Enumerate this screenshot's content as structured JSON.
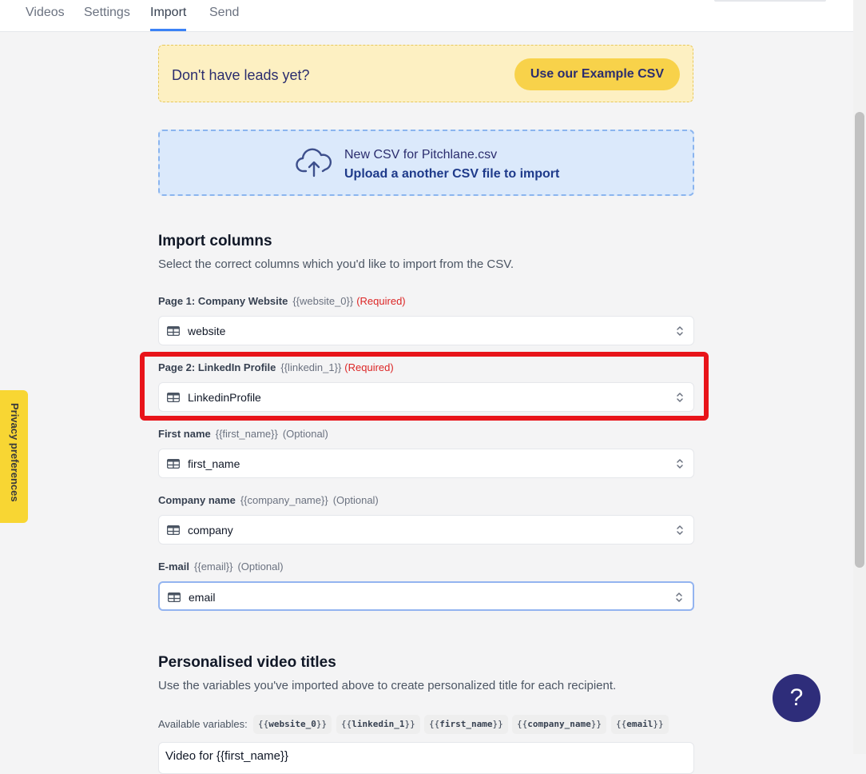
{
  "nav": {
    "tabs": [
      {
        "label": "Videos"
      },
      {
        "label": "Settings"
      },
      {
        "label": "Import"
      },
      {
        "label": "Send"
      }
    ]
  },
  "banner": {
    "text": "Don't have leads yet?",
    "button_label": "Use our Example CSV"
  },
  "upload": {
    "icon": "cloud-upload-icon",
    "filename": "New CSV for Pitchlane.csv",
    "hint": "Upload a another CSV file to import"
  },
  "import_columns": {
    "heading": "Import columns",
    "subtitle": "Select the correct columns which you'd like to import from the CSV.",
    "fields": [
      {
        "label": "Page 1: Company Website",
        "variable": "{{website_0}}",
        "status": "(Required)",
        "value": "website"
      },
      {
        "label": "Page 2: LinkedIn Profile",
        "variable": "{{linkedin_1}}",
        "status": "(Required)",
        "value": "LinkedinProfile"
      },
      {
        "label": "First name",
        "variable": "{{first_name}}",
        "status": "(Optional)",
        "value": "first_name"
      },
      {
        "label": "Company name",
        "variable": "{{company_name}}",
        "status": "(Optional)",
        "value": "company"
      },
      {
        "label": "E-mail",
        "variable": "{{email}}",
        "status": "(Optional)",
        "value": "email"
      }
    ]
  },
  "video_titles": {
    "heading": "Personalised video titles",
    "subtitle": "Use the variables you've imported above to create personalized title for each recipient.",
    "available_label": "Available variables:",
    "chips": [
      {
        "open": "{{",
        "name": "website_0",
        "close": "}}"
      },
      {
        "open": "{{",
        "name": "linkedin_1",
        "close": "}}"
      },
      {
        "open": "{{",
        "name": "first_name",
        "close": "}}"
      },
      {
        "open": "{{",
        "name": "company_name",
        "close": "}}"
      },
      {
        "open": "{{",
        "name": "email",
        "close": "}}"
      }
    ],
    "title_value": "Video for {{first_name}}"
  },
  "privacy": {
    "label": "Privacy preferences"
  },
  "help": {
    "label": "?"
  },
  "colors": {
    "accent": "#3b82f6",
    "banner_bg": "#fdf0c2",
    "banner_button": "#f8d24a",
    "upload_bg": "#dbe9fb",
    "required": "#dc2626",
    "highlight_box": "#e8141a",
    "help_button": "#2e2d7a",
    "privacy_tab": "#f8d633"
  }
}
